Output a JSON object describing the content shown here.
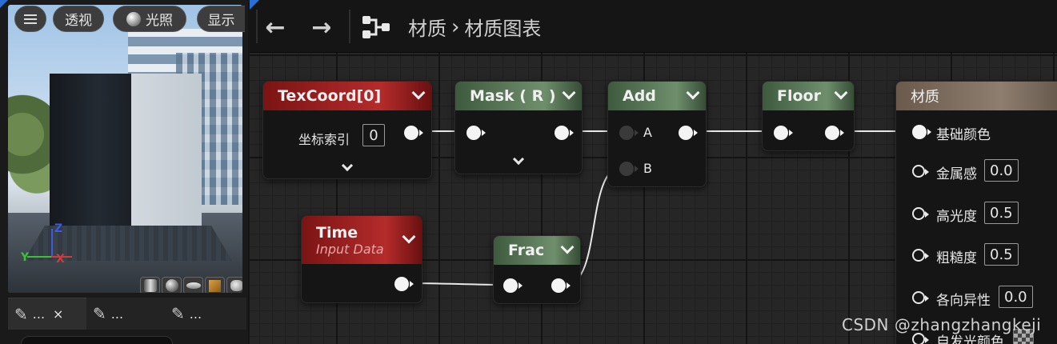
{
  "viewport": {
    "menu_icon": "hamburger-icon",
    "perspective_label": "透视",
    "lighting_label": "光照",
    "show_label": "显示",
    "axis_z": "Z",
    "axis_x": "X",
    "axis_y": "Y",
    "preview_shapes": [
      "cylinder-icon",
      "sphere-icon",
      "plane-icon",
      "cube-icon",
      "teapot-icon"
    ]
  },
  "details_tabs": [
    {
      "label": "...",
      "icon": "pencil-icon",
      "closable": true
    },
    {
      "label": "...",
      "icon": "pencil-icon",
      "closable": false
    },
    {
      "label": "...",
      "icon": "pencil-icon",
      "closable": false
    }
  ],
  "tab_close_glyph": "×",
  "toolbar": {
    "back_glyph": "←",
    "forward_glyph": "→",
    "breadcrumb_root": "材质",
    "breadcrumb_separator": "›",
    "breadcrumb_current": "材质图表"
  },
  "nodes": {
    "texcoord": {
      "title": "TexCoord[0]",
      "input_label": "坐标索引",
      "input_value": "0"
    },
    "mask": {
      "title": "Mask ( R )"
    },
    "add": {
      "title": "Add",
      "pin_a": "A",
      "pin_b": "B"
    },
    "floor": {
      "title": "Floor"
    },
    "time": {
      "title": "Time",
      "subtitle": "Input Data"
    },
    "frac": {
      "title": "Frac"
    },
    "material": {
      "title": "材质",
      "base_color_label": "基础颜色",
      "metallic_label": "金属感",
      "metallic_value": "0.0",
      "specular_label": "高光度",
      "specular_value": "0.5",
      "roughness_label": "粗糙度",
      "roughness_value": "0.5",
      "anisotropy_label": "各向异性",
      "anisotropy_value": "0.0",
      "emissive_label": "自发光颜色"
    }
  },
  "watermark": "CSDN @zhangzhangkeji"
}
